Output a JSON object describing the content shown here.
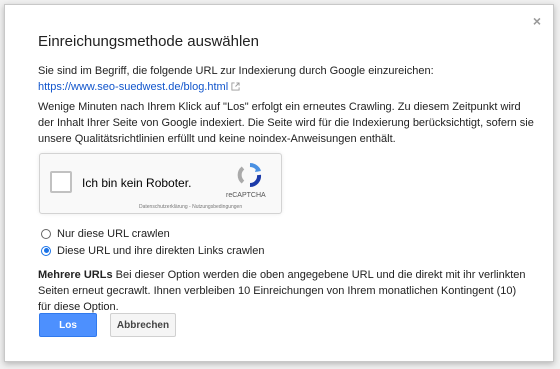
{
  "dialog": {
    "title": "Einreichungsmethode auswählen",
    "close_label": "×",
    "intro_text": "Sie sind im Begriff, die folgende URL zur Indexierung durch Google einzureichen:",
    "url": "https://www.seo-suedwest.de/blog.html",
    "info_text": "Wenige Minuten nach Ihrem Klick auf \"Los\" erfolgt ein erneutes Crawling. Zu diesem Zeitpunkt wird der Inhalt Ihrer Seite von Google indexiert. Die Seite wird für die Indexierung berücksichtigt, sofern sie unsere Qualitätsrichtlinien erfüllt und keine noindex-Anweisungen enthält.",
    "captcha": {
      "label": "Ich bin kein Roboter.",
      "brand": "reCAPTCHA",
      "links": "Datenschutzerklärung - Nutzungsbedingungen"
    },
    "options": [
      {
        "label": "Nur diese URL crawlen",
        "selected": false
      },
      {
        "label": "Diese URL und ihre direkten Links crawlen",
        "selected": true
      }
    ],
    "multi_title": "Mehrere URLs",
    "multi_text": " Bei dieser Option werden die oben angegebene URL und die direkt mit ihr verlinkten Seiten erneut gecrawlt. Ihnen verbleiben 10 Einreichungen von Ihrem monatlichen Kontingent (10) für diese Option.",
    "buttons": {
      "primary": "Los",
      "secondary": "Abbrechen"
    }
  },
  "colors": {
    "accent": "#4d90fe",
    "link": "#1155cc"
  }
}
